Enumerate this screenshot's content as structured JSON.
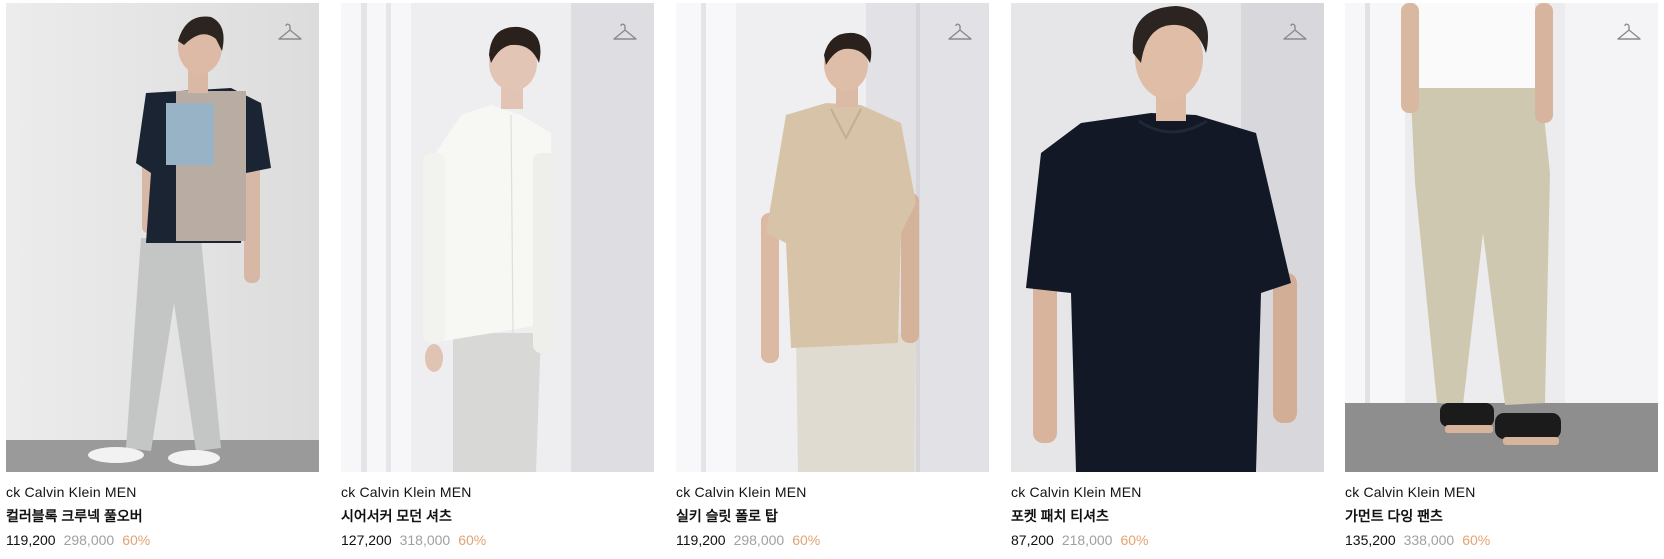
{
  "products": [
    {
      "brand": "ck Calvin Klein MEN",
      "name": "컬러블록 크루넥 풀오버",
      "sale_price": "119,200",
      "original_price": "298,000",
      "discount": "60%",
      "wishlist_icon": "hanger-icon"
    },
    {
      "brand": "ck Calvin Klein MEN",
      "name": "시어서커 모던 셔츠",
      "sale_price": "127,200",
      "original_price": "318,000",
      "discount": "60%",
      "wishlist_icon": "hanger-icon"
    },
    {
      "brand": "ck Calvin Klein MEN",
      "name": "실키 슬릿 폴로 탑",
      "sale_price": "119,200",
      "original_price": "298,000",
      "discount": "60%",
      "wishlist_icon": "hanger-icon"
    },
    {
      "brand": "ck Calvin Klein MEN",
      "name": "포켓 패치 티셔츠",
      "sale_price": "87,200",
      "original_price": "218,000",
      "discount": "60%",
      "wishlist_icon": "hanger-icon"
    },
    {
      "brand": "ck Calvin Klein MEN",
      "name": "가먼트 다잉 팬츠",
      "sale_price": "135,200",
      "original_price": "338,000",
      "discount": "60%",
      "wishlist_icon": "hanger-icon"
    }
  ],
  "colors": {
    "discount": "#e3a372",
    "original_price": "#a0a0a0",
    "text": "#111111"
  }
}
